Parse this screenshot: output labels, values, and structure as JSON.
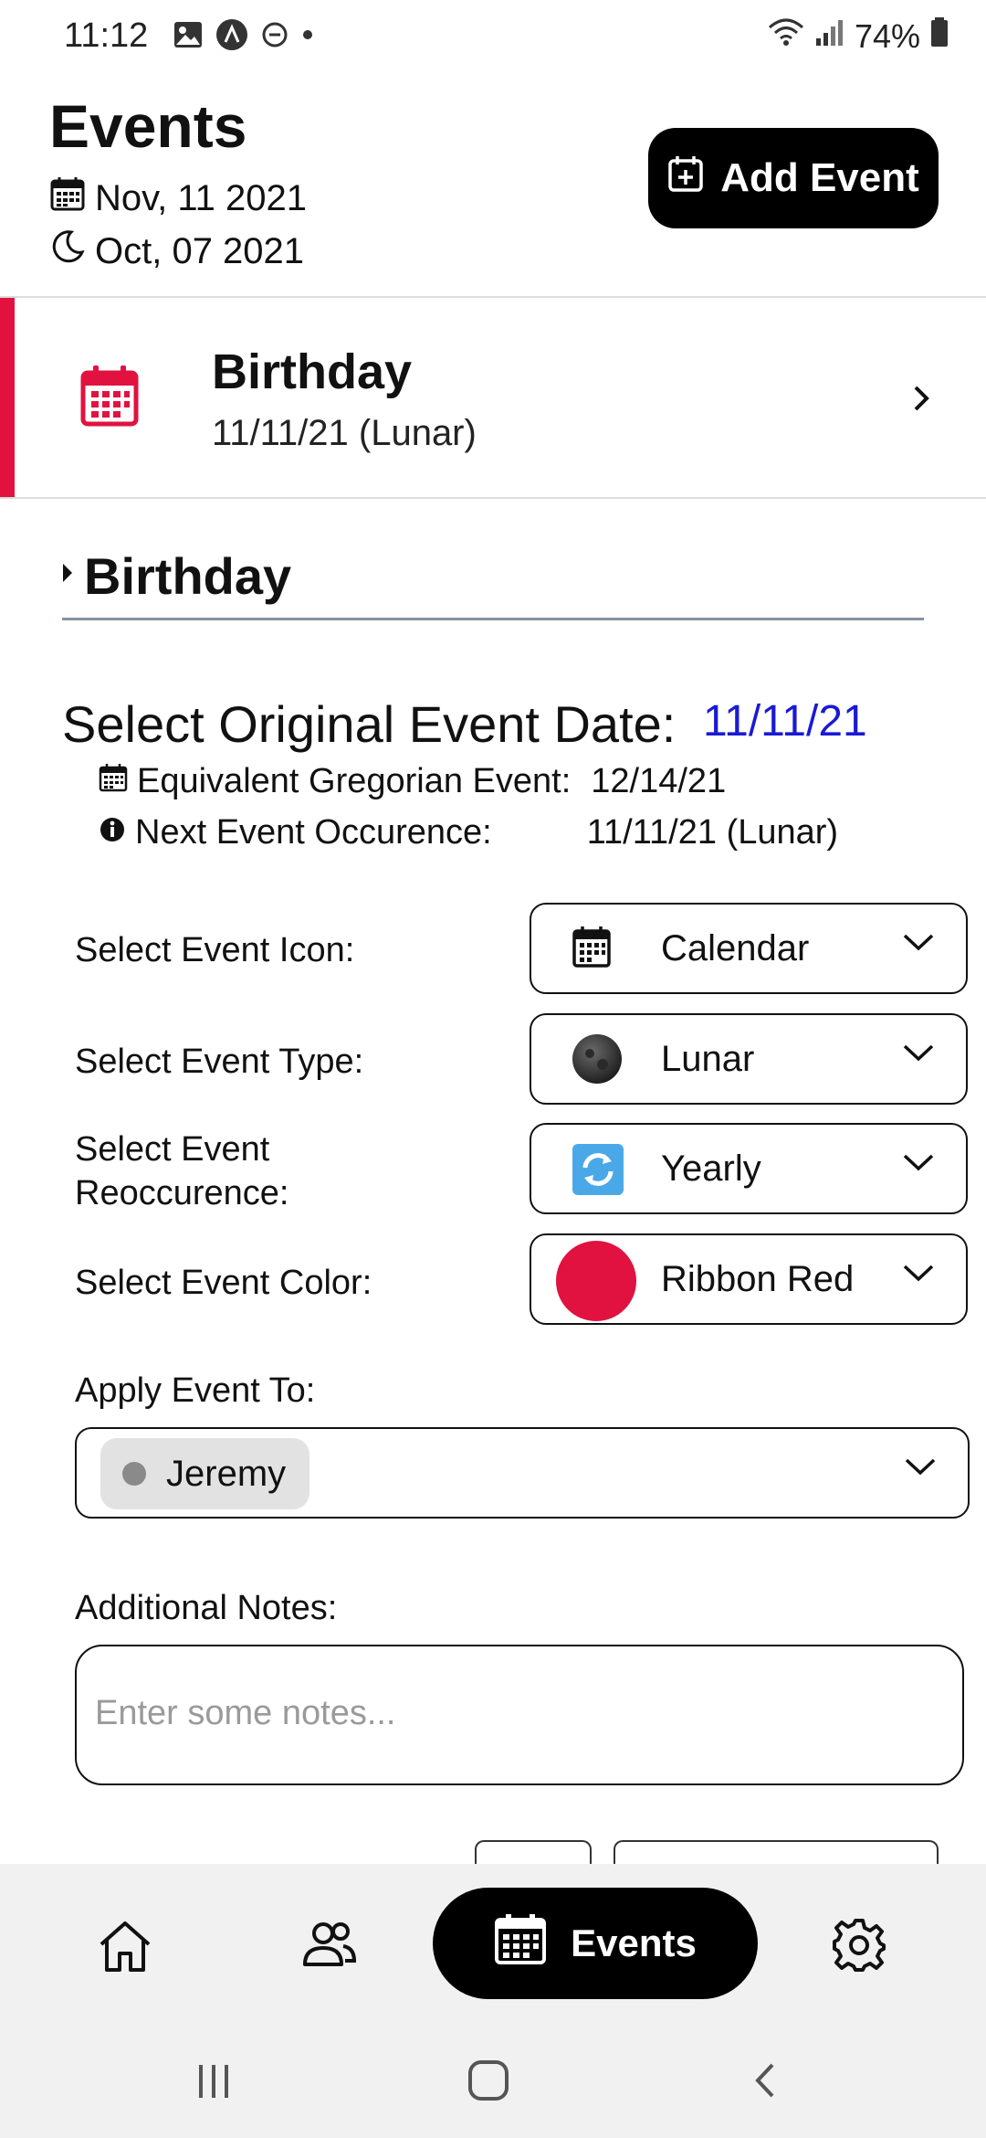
{
  "status_bar": {
    "time": "11:12",
    "battery": "74%"
  },
  "header": {
    "title": "Events",
    "gregorian_date": "Nov, 11 2021",
    "lunar_date": "Oct, 07 2021",
    "add_button_label": "Add Event"
  },
  "event_card": {
    "name": "Birthday",
    "date": "11/11/21 (Lunar)",
    "accent_color": "#e11240"
  },
  "detail": {
    "section_title": "Birthday",
    "original_date_label": "Select Original Event Date:",
    "original_date_value": "11/11/21",
    "gregorian_label": "Equivalent Gregorian Event:",
    "gregorian_value": "12/14/21",
    "next_label": "Next Event Occurence:",
    "next_value": "11/11/21 (Lunar)"
  },
  "form": {
    "icon_label": "Select Event Icon:",
    "icon_value": "Calendar",
    "type_label": "Select Event Type:",
    "type_value": "Lunar",
    "recurrence_label_line1": "Select Event",
    "recurrence_label_line2": "Reoccurence:",
    "recurrence_value": "Yearly",
    "color_label": "Select Event Color:",
    "color_value": "Ribbon Red",
    "color_hex": "#e11240",
    "apply_label": "Apply Event To:",
    "apply_chip": "Jeremy",
    "notes_label": "Additional Notes:",
    "notes_placeholder": "Enter some notes..."
  },
  "bottom_nav": {
    "active_label": "Events",
    "items": [
      "home-icon",
      "people-icon",
      "events-icon",
      "settings-icon"
    ]
  }
}
